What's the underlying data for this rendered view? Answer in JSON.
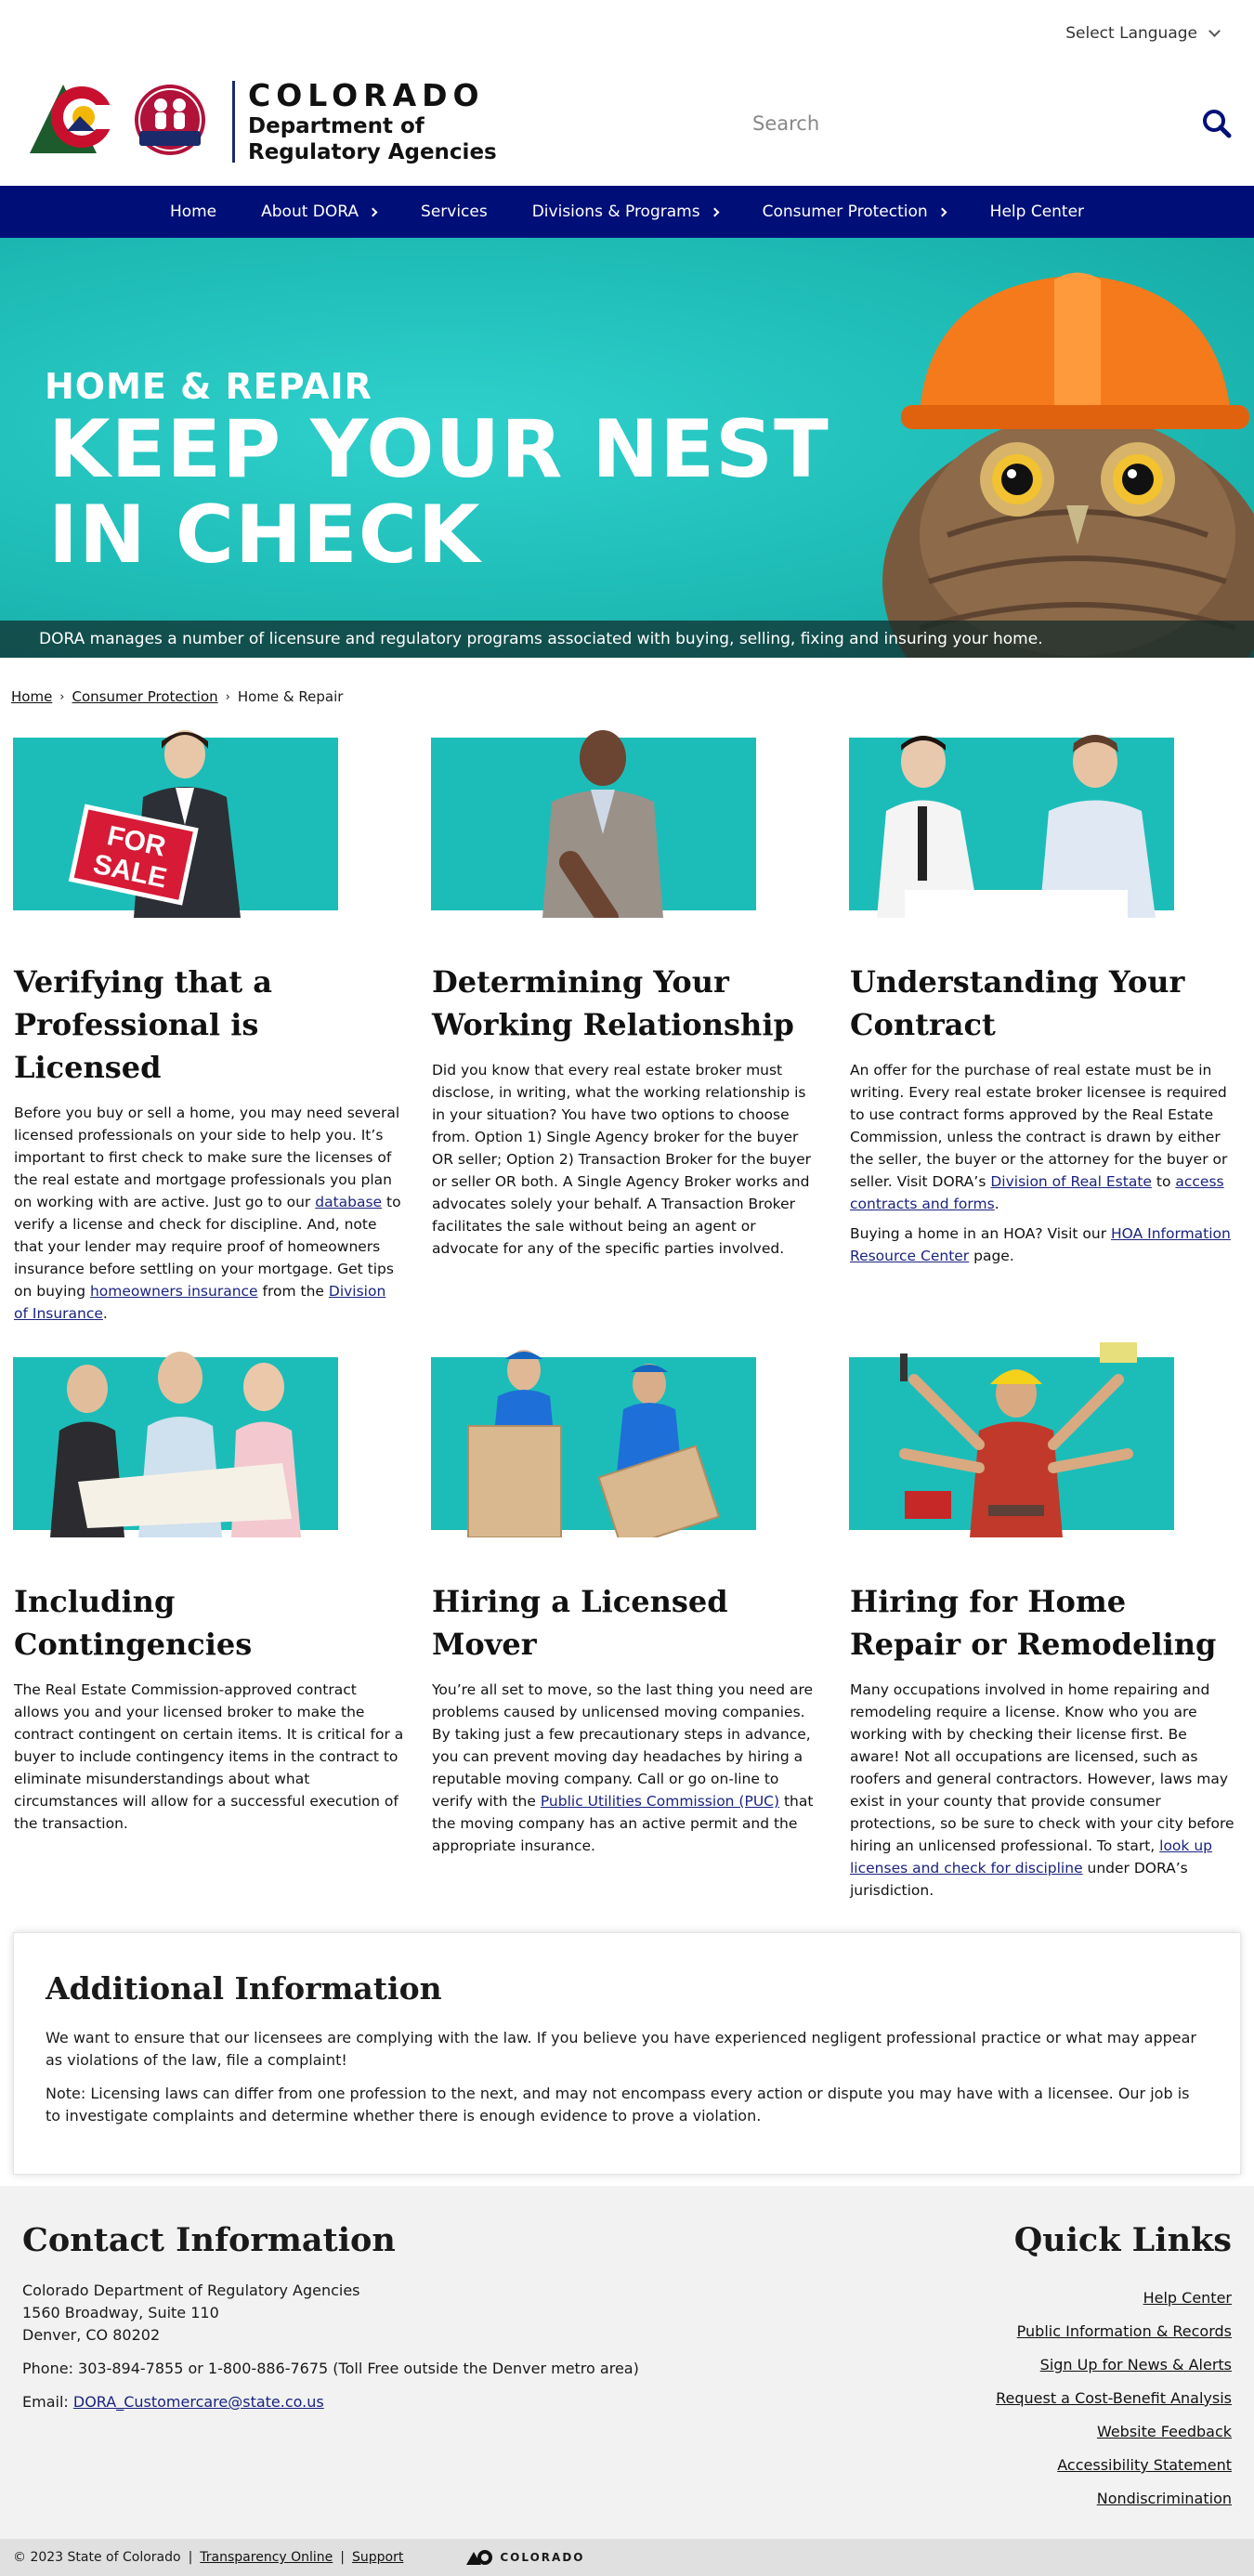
{
  "utility": {
    "language_label": "Select Language"
  },
  "header": {
    "brand_name": "COLORADO",
    "agency_line1": "Department of",
    "agency_line2": "Regulatory Agencies",
    "dora_badge": "DORA",
    "search_placeholder": "Search"
  },
  "nav": {
    "items": [
      {
        "label": "Home",
        "has_submenu": false
      },
      {
        "label": "About DORA",
        "has_submenu": true
      },
      {
        "label": "Services",
        "has_submenu": false
      },
      {
        "label": "Divisions & Programs",
        "has_submenu": true
      },
      {
        "label": "Consumer Protection",
        "has_submenu": true
      },
      {
        "label": "Help Center",
        "has_submenu": false
      }
    ]
  },
  "hero": {
    "kicker": "HOME & REPAIR",
    "headline_line1": "KEEP YOUR NEST",
    "headline_line2": "IN CHECK",
    "caption": "DORA manages a number of licensure and regulatory programs associated with buying, selling, fixing and insuring your home."
  },
  "breadcrumb": {
    "home": "Home",
    "consumer_protection": "Consumer Protection",
    "current": "Home & Repair"
  },
  "cards": {
    "verify": {
      "title": "Verifying that a Professional is Licensed",
      "sign_text_1": "FOR",
      "sign_text_2": "SALE",
      "p1_a": "Before you buy or sell a home, you may need several licensed professionals on your side to help you. It’s important to first check to make sure the licenses of the real estate and mortgage professionals you plan on working with are active. Just go to our ",
      "p1_link": "database",
      "p1_b": " to verify a license and check for discipline. And, note that your lender may require proof of homeowners insurance before settling on your mortgage. Get tips on buying ",
      "p1_link2": "homeowners insurance",
      "p1_c": " from the ",
      "p1_link3": "Division of Insurance",
      "p1_d": "."
    },
    "relationship": {
      "title": "Determining Your Working Relationship",
      "p1": "Did you know that every real estate broker must disclose, in writing, what the working relationship is in your situation? You have two options to choose from. Option 1) Single Agency broker for the buyer OR seller; Option 2) Transaction Broker for the buyer or seller OR both. A Single Agency Broker works and advocates solely your behalf. A Transaction Broker facilitates the sale without being an agent or advocate for any of the specific parties involved."
    },
    "contract": {
      "title": "Understanding Your Contract",
      "p1_a": "An offer for the purchase of real estate must be in writing. Every real estate broker licensee is required to use contract forms approved by the Real Estate Commission, unless the contract is drawn by either the seller, the buyer or the attorney for the buyer or seller. Visit DORA’s ",
      "p1_link": "Division of Real Estate",
      "p1_b": " to ",
      "p1_link2": "access contracts and forms",
      "p1_c": ".",
      "p2_a": "Buying a home in an HOA? Visit our ",
      "p2_link": "HOA Information Resource Center",
      "p2_b": " page."
    },
    "contingencies": {
      "title": "Including Contingencies",
      "p1": "The Real Estate Commission-approved contract allows you and your licensed broker to make the contract contingent on certain items. It is critical for a buyer to include contingency items in the contract to eliminate misunderstandings about what circumstances will allow for a successful execution of the transaction."
    },
    "mover": {
      "title": "Hiring a Licensed Mover",
      "p1_a": "You’re all set to move, so the last thing you need are problems caused by unlicensed moving companies. By taking just a few precautionary steps in advance, you can prevent moving day headaches by hiring a reputable moving company. Call or go on-line to verify with the ",
      "p1_link": "Public Utilities Commission (PUC)",
      "p1_b": " that the moving company has an active permit and the appropriate insurance."
    },
    "repair": {
      "title": "Hiring for Home Repair or Remodeling",
      "p1_a": "Many occupations involved in home repairing and remodeling require a license. Know who you are working with by checking their license first. Be aware! Not all occupations are licensed, such as roofers and general contractors. However, laws may exist in your county that provide consumer protections, so be sure to check with your city before hiring an unlicensed professional. To start, ",
      "p1_link": "look up licenses and check for discipline",
      "p1_b": " under DORA’s jurisdiction."
    }
  },
  "additional": {
    "title": "Additional Information",
    "p1": "We want to ensure that our licensees are complying with the law. If you believe you have experienced negligent professional practice or what may appear as violations of the law, file a complaint!",
    "p2": "Note: Licensing laws can differ from one profession to the next, and may not encompass every action or dispute you may have with a licensee. Our job is to investigate complaints and determine whether there is enough evidence to prove a violation."
  },
  "footer": {
    "contact_title": "Contact Information",
    "org": "Colorado Department of Regulatory Agencies",
    "address1": "1560 Broadway, Suite 110",
    "address2": "Denver, CO 80202",
    "phone": "Phone: 303-894-7855 or 1-800-886-7675 (Toll Free outside the Denver metro area)",
    "email_label": "Email: ",
    "email": "DORA_Customercare@state.co.us",
    "quick_title": "Quick Links",
    "quick_links": [
      "Help Center",
      "Public Information & Records",
      "Sign Up for News & Alerts",
      "Request a Cost-Benefit Analysis",
      "Website Feedback",
      "Accessibility Statement",
      "Nondiscrimination"
    ]
  },
  "bottombar": {
    "copyright": "© 2023 State of Colorado",
    "sep": "|",
    "transparency": "Transparency Online",
    "support": "Support",
    "brand": "COLORADO"
  }
}
